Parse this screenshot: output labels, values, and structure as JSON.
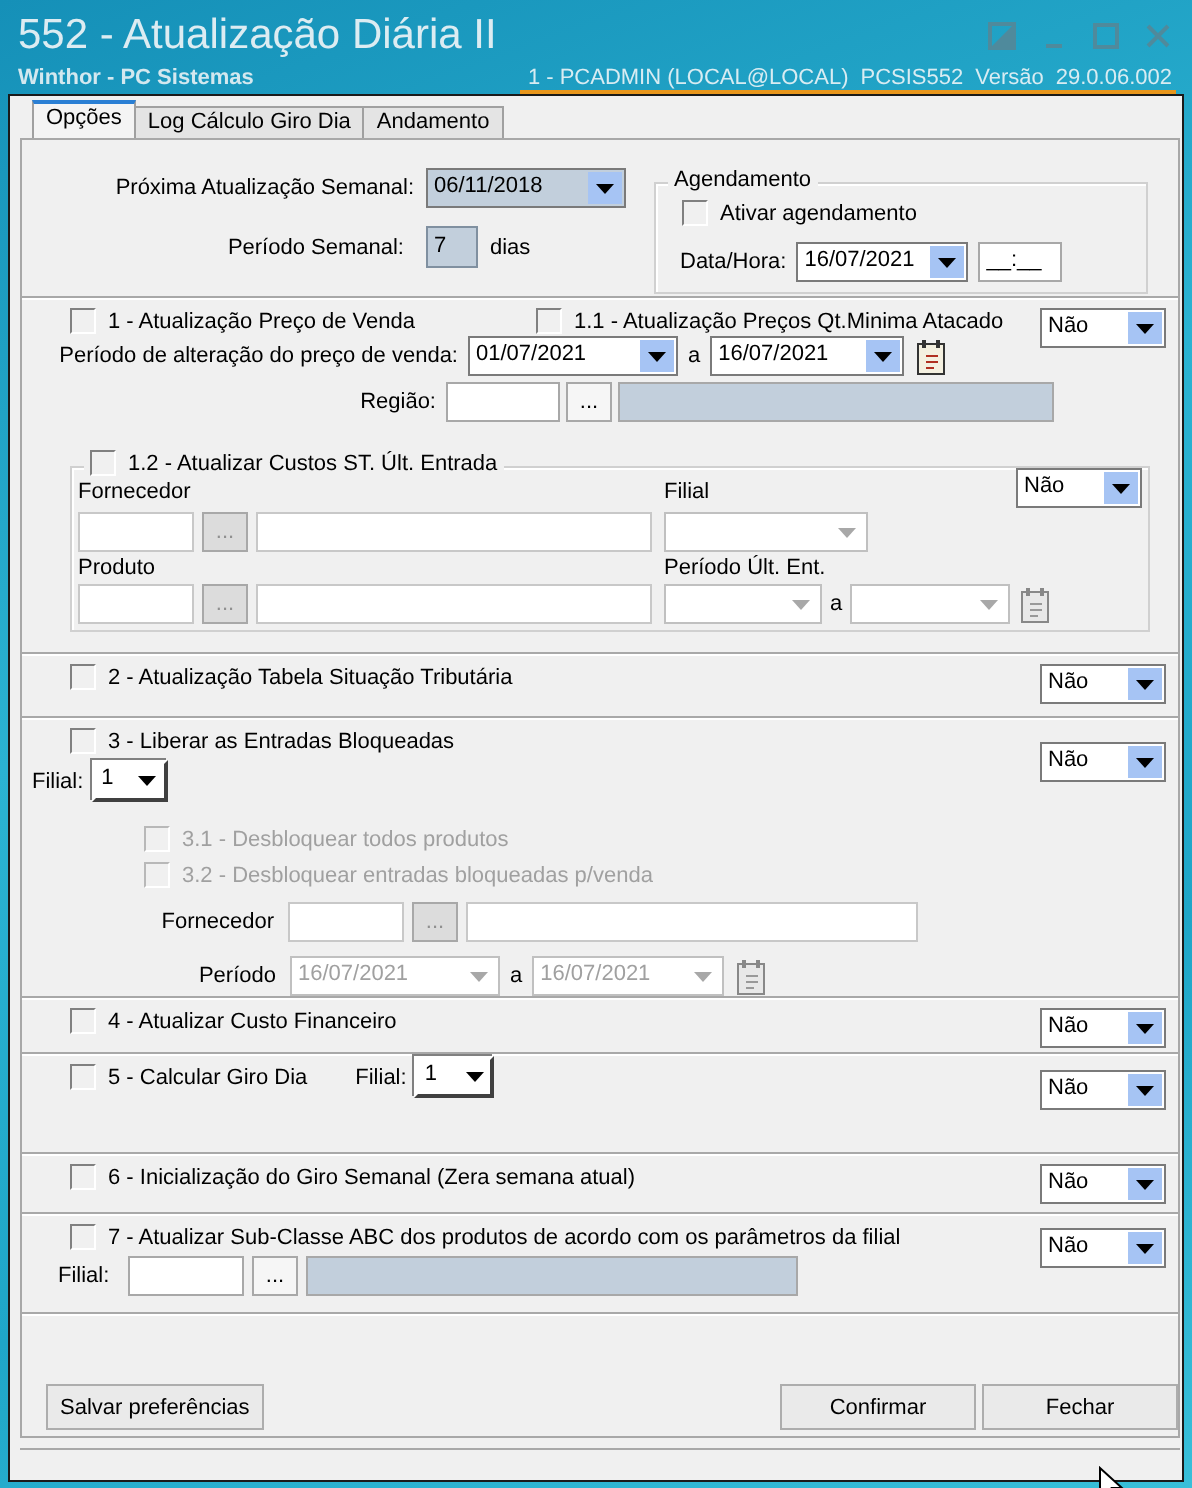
{
  "window": {
    "title": "552 - Atualização Diária II",
    "subtitle": "Winthor - PC Sistemas",
    "session": "1 - PCADMIN (LOCAL@LOCAL)",
    "program": "PCSIS552",
    "version_label": "Versão",
    "version": "29.0.06.002"
  },
  "tabs": [
    {
      "label": "Opções",
      "selected": true
    },
    {
      "label": "Log Cálculo Giro Dia",
      "selected": false
    },
    {
      "label": "Andamento",
      "selected": false
    }
  ],
  "weekly": {
    "next_update_label": "Próxima Atualização Semanal:",
    "next_update": "06/11/2018",
    "period_label": "Período Semanal:",
    "period": "7",
    "period_unit": "dias"
  },
  "schedule": {
    "title": "Agendamento",
    "enable_label": "Ativar agendamento",
    "enabled": false,
    "datetime_label": "Data/Hora:",
    "date": "16/07/2021",
    "time": "__:__"
  },
  "section_1": {
    "option": {
      "label": "1 - Atualização Preço de Venda",
      "checked": false
    },
    "option_1_1": {
      "label": "1.1 - Atualização Preços Qt.Minima Atacado",
      "checked": false
    },
    "mode": "Não",
    "period_label": "Período de alteração do preço de venda:",
    "date_from": "01/07/2021",
    "to_label": "a",
    "date_to": "16/07/2021",
    "region_label": "Região:",
    "region_browse": "..."
  },
  "section_1_2": {
    "option": {
      "label": "1.2 - Atualizar Custos ST. Últ. Entrada",
      "checked": false
    },
    "mode": "Não",
    "disabled": true,
    "supplier_label": "Fornecedor",
    "supplier_browse": "...",
    "branch_label": "Filial",
    "product_label": "Produto",
    "product_browse": "...",
    "period_label": "Período Últ. Ent.",
    "to_label": "a"
  },
  "section_2": {
    "option": {
      "label": "2 - Atualização Tabela Situação Tributária",
      "checked": false
    },
    "mode": "Não"
  },
  "section_3": {
    "option": {
      "label": "3 - Liberar as Entradas Bloqueadas",
      "checked": false
    },
    "mode": "Não",
    "branch_label": "Filial:",
    "branch": "1",
    "sub_options": [
      {
        "label": "3.1 - Desbloquear todos produtos",
        "checked": false,
        "disabled": true
      },
      {
        "label": "3.2 - Desbloquear entradas bloqueadas p/venda",
        "checked": false,
        "disabled": true
      }
    ],
    "disabled": true,
    "supplier_label": "Fornecedor",
    "supplier_browse": "...",
    "period_label": "Período",
    "date_from": "16/07/2021",
    "to_label": "a",
    "date_to": "16/07/2021"
  },
  "section_4": {
    "option": {
      "label": "4 - Atualizar Custo Financeiro",
      "checked": false
    },
    "mode": "Não"
  },
  "section_5": {
    "option": {
      "label": "5 - Calcular Giro Dia",
      "checked": false
    },
    "mode": "Não",
    "branch_label": "Filial:",
    "branch": "1"
  },
  "section_6": {
    "option": {
      "label": "6 - Inicialização do Giro Semanal (Zera semana atual)",
      "checked": false
    },
    "mode": "Não"
  },
  "section_7": {
    "option": {
      "label": "7 - Atualizar Sub-Classe ABC dos produtos de acordo com os parâmetros da filial",
      "checked": false
    },
    "mode": "Não",
    "branch_label": "Filial:",
    "branch_browse": "..."
  },
  "buttons": [
    {
      "label": "Salvar preferências"
    },
    {
      "label": "Confirmar"
    },
    {
      "label": "Fechar"
    }
  ]
}
